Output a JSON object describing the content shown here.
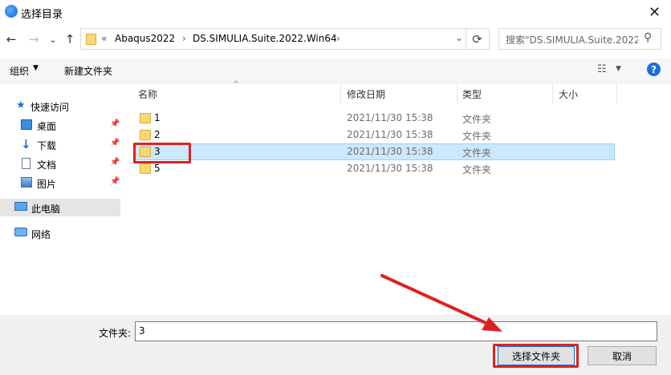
{
  "window": {
    "title": "选择目录",
    "close_glyph": "✕"
  },
  "nav": {
    "back_glyph": "←",
    "forward_glyph": "→",
    "recent_glyph": "⌄",
    "up_glyph": "↑",
    "address": {
      "overflow": "«",
      "segments": [
        "Abaqus2022",
        "DS.SIMULIA.Suite.2022.Win64"
      ],
      "separator": "›",
      "dropdown_glyph": "⌄"
    },
    "refresh_glyph": "⟳",
    "search_placeholder": "搜索\"DS.SIMULIA.Suite.2022...",
    "search_glyph": "⚲"
  },
  "toolbar": {
    "organize_label": "组织",
    "organize_caret": "▼",
    "new_folder_label": "新建文件夹",
    "view_glyph": "☷",
    "view_caret": "▼",
    "help_glyph": "?"
  },
  "sidebar": {
    "quick_access": "快速访问",
    "items": [
      {
        "label": "桌面",
        "pin": "📌"
      },
      {
        "label": "下载",
        "pin": "📌"
      },
      {
        "label": "文档",
        "pin": "📌"
      },
      {
        "label": "图片",
        "pin": "📌"
      }
    ],
    "this_pc": "此电脑",
    "network": "网络"
  },
  "columns": {
    "name": "名称",
    "date": "修改日期",
    "type": "类型",
    "size": "大小",
    "sort_glyph": "^"
  },
  "files": [
    {
      "name": "1",
      "date": "2021/11/30 15:38",
      "type": "文件夹"
    },
    {
      "name": "2",
      "date": "2021/11/30 15:38",
      "type": "文件夹"
    },
    {
      "name": "3",
      "date": "2021/11/30 15:38",
      "type": "文件夹",
      "selected": true
    },
    {
      "name": "5",
      "date": "2021/11/30 15:38",
      "type": "文件夹"
    }
  ],
  "footer": {
    "filename_label": "文件夹:",
    "filename_value": "3",
    "select_label": "选择文件夹",
    "cancel_label": "取消"
  },
  "colors": {
    "selection": "#cce8ff",
    "accent": "#0078d7",
    "annotation": "#e02020"
  }
}
